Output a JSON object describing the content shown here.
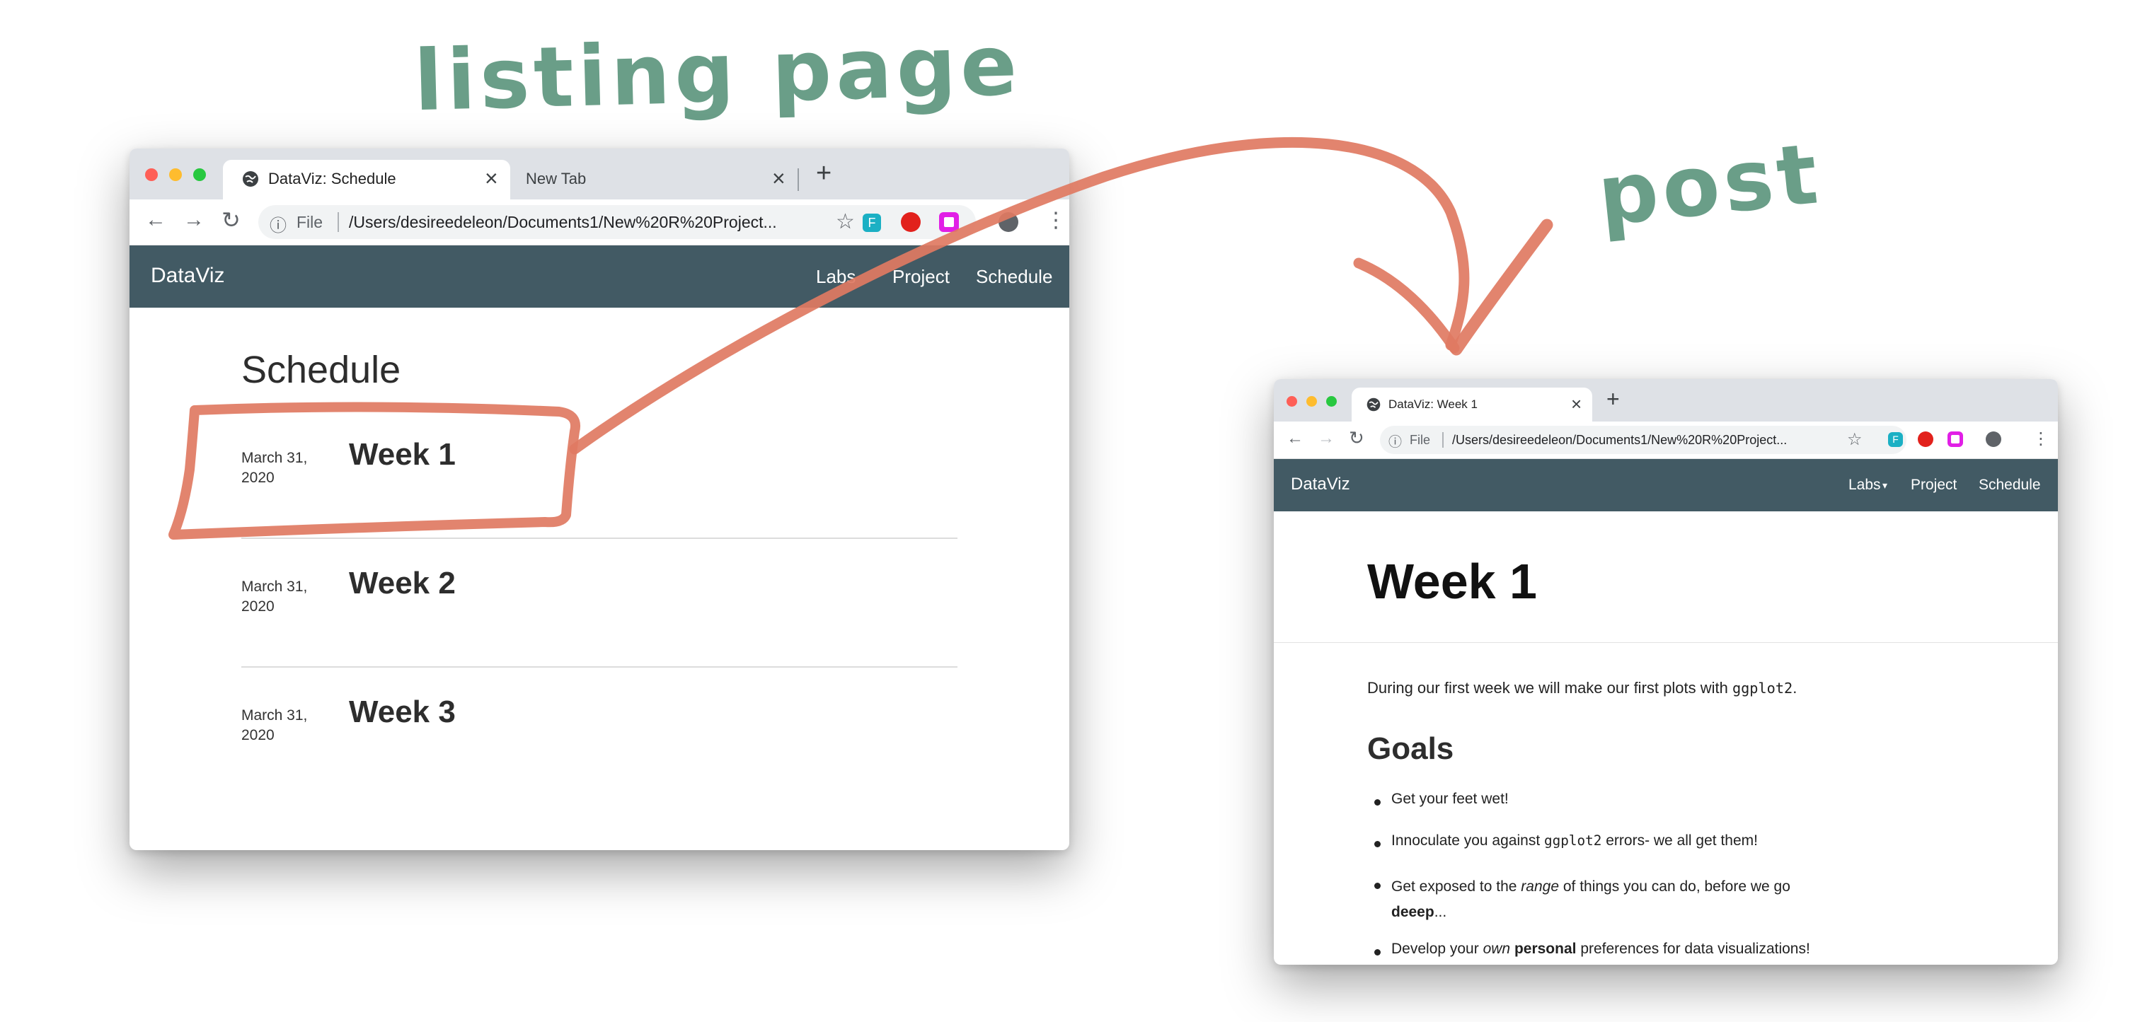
{
  "annotations": {
    "listing_label": "listing page",
    "post_label": "post"
  },
  "listing_window": {
    "tabs": [
      {
        "title": "DataViz: Schedule",
        "close": "×"
      },
      {
        "title": "New Tab",
        "close": "×"
      }
    ],
    "new_tab": "+",
    "omnibox": {
      "info": "ⓘ",
      "scheme": "File",
      "url": "/Users/desireedeleon/Documents1/New%20R%20Project..."
    },
    "brand": "DataViz",
    "nav": [
      "Labs",
      "Project",
      "Schedule"
    ],
    "page_title": "Schedule",
    "entries": [
      {
        "date_line1": "March 31,",
        "date_line2": "2020",
        "title": "Week 1"
      },
      {
        "date_line1": "March 31,",
        "date_line2": "2020",
        "title": "Week 2"
      },
      {
        "date_line1": "March 31,",
        "date_line2": "2020",
        "title": "Week 3"
      }
    ]
  },
  "post_window": {
    "tab": {
      "title": "DataViz: Week 1",
      "close": "×"
    },
    "new_tab": "+",
    "omnibox": {
      "info": "ⓘ",
      "scheme": "File",
      "url": "/Users/desireedeleon/Documents1/New%20R%20Project..."
    },
    "brand": "DataViz",
    "nav": [
      "Labs",
      "Project",
      "Schedule"
    ],
    "nav_caret": "▾",
    "h1": "Week 1",
    "intro_before": "During our first week we will make our first plots with ",
    "intro_code": "ggplot2",
    "intro_after": ".",
    "goals_heading": "Goals",
    "goals": {
      "g1": "Get your feet wet!",
      "g2_before": "Innoculate you against ",
      "g2_code": "ggplot2",
      "g2_after": " errors- we all get them!",
      "g3_before": "Get exposed to the ",
      "g3_em": "range",
      "g3_after": " of things you can do, before we go",
      "g3_bold": "deeep",
      "g3_end": "...",
      "g4_before": "Develop your ",
      "g4_em": "own",
      "g4_space": " ",
      "g4_bold": "personal",
      "g4_after": " preferences for data visualizations!"
    }
  },
  "icons": {
    "back": "←",
    "forward": "→",
    "reload": "↻",
    "star": "☆",
    "menu": "⋮",
    "globe": "🌐"
  },
  "colors": {
    "navbar": "#425a64",
    "annotation_green": "#6a9e88",
    "annotation_stroke": "#e07a62",
    "traffic_red": "#fe5f57",
    "traffic_yellow": "#febc2e",
    "traffic_green": "#28c840"
  }
}
